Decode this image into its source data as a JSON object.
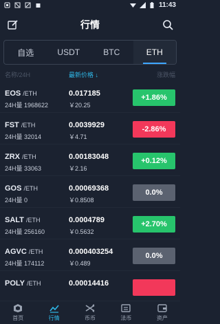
{
  "statusbar": {
    "time": "11:43"
  },
  "header": {
    "title": "行情"
  },
  "tabs": [
    {
      "label": "自选",
      "active": false
    },
    {
      "label": "USDT",
      "active": false
    },
    {
      "label": "BTC",
      "active": false
    },
    {
      "label": "ETH",
      "active": true
    }
  ],
  "columns": {
    "name": "名称/24H",
    "price": "最新价格 ↓",
    "change": "涨跌幅"
  },
  "rows": [
    {
      "base": "EOS",
      "quote": "/ETH",
      "vol": "24H量  1968622",
      "price": "0.017185",
      "cny": "￥20.25",
      "change": "+1.86%",
      "direction": "up"
    },
    {
      "base": "FST",
      "quote": "/ETH",
      "vol": "24H量  32014",
      "price": "0.0039929",
      "cny": "￥4.71",
      "change": "-2.86%",
      "direction": "down"
    },
    {
      "base": "ZRX",
      "quote": "/ETH",
      "vol": "24H量  33063",
      "price": "0.00183048",
      "cny": "￥2.16",
      "change": "+0.12%",
      "direction": "up"
    },
    {
      "base": "GOS",
      "quote": "/ETH",
      "vol": "24H量  0",
      "price": "0.00069368",
      "cny": "￥0.8508",
      "change": "0.0%",
      "direction": "flat"
    },
    {
      "base": "SALT",
      "quote": "/ETH",
      "vol": "24H量  256160",
      "price": "0.0004789",
      "cny": "￥0.5632",
      "change": "+2.70%",
      "direction": "up"
    },
    {
      "base": "AGVC",
      "quote": "/ETH",
      "vol": "24H量  174112",
      "price": "0.000403254",
      "cny": "￥0.489",
      "change": "0.0%",
      "direction": "flat"
    },
    {
      "base": "POLY",
      "quote": "/ETH",
      "vol": "",
      "price": "0.00014416",
      "cny": "",
      "change": "",
      "direction": "down"
    }
  ],
  "nav": [
    {
      "label": "首页",
      "icon": "home-icon",
      "active": false
    },
    {
      "label": "行情",
      "icon": "market-chart-icon",
      "active": true
    },
    {
      "label": "币币",
      "icon": "exchange-icon",
      "active": false
    },
    {
      "label": "法币",
      "icon": "fiat-icon",
      "active": false
    },
    {
      "label": "资产",
      "icon": "wallet-icon",
      "active": false
    }
  ],
  "colors": {
    "background": "#1b2230",
    "up": "#27c46c",
    "down": "#f2385a",
    "flat": "#5b6270",
    "accent": "#2fb8e8"
  }
}
